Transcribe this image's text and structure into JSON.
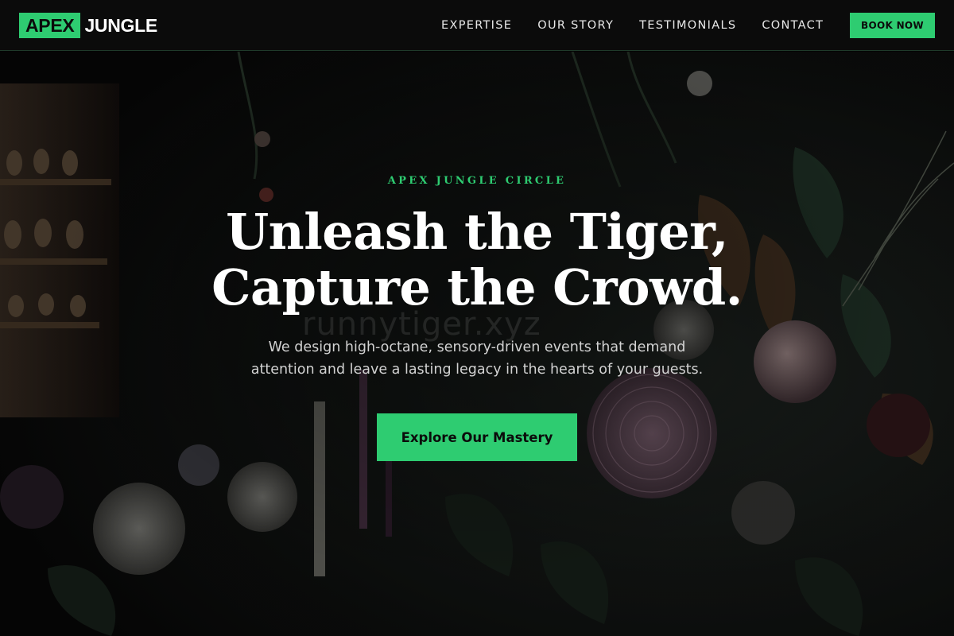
{
  "brand": {
    "logo_box_text": "APEX",
    "logo_text": "JUNGLE",
    "accent_color": "#2ecc71"
  },
  "nav": {
    "links": [
      "EXPERTISE",
      "OUR STORY",
      "TESTIMONIALS",
      "CONTACT"
    ],
    "book_label": "BOOK NOW"
  },
  "hero": {
    "eyebrow": "APEX JUNGLE CIRCLE",
    "headline_line1": "Unleash the Tiger,",
    "headline_line2": "Capture the Crowd.",
    "subtext_line1": "We design high-octane, sensory-driven events that demand",
    "subtext_line2": "attention and leave a lasting legacy in the hearts of your guests.",
    "cta_label": "Explore Our Mastery",
    "watermark": "runnytiger.xyz",
    "background_image": "dark floral arrangement with candles"
  }
}
